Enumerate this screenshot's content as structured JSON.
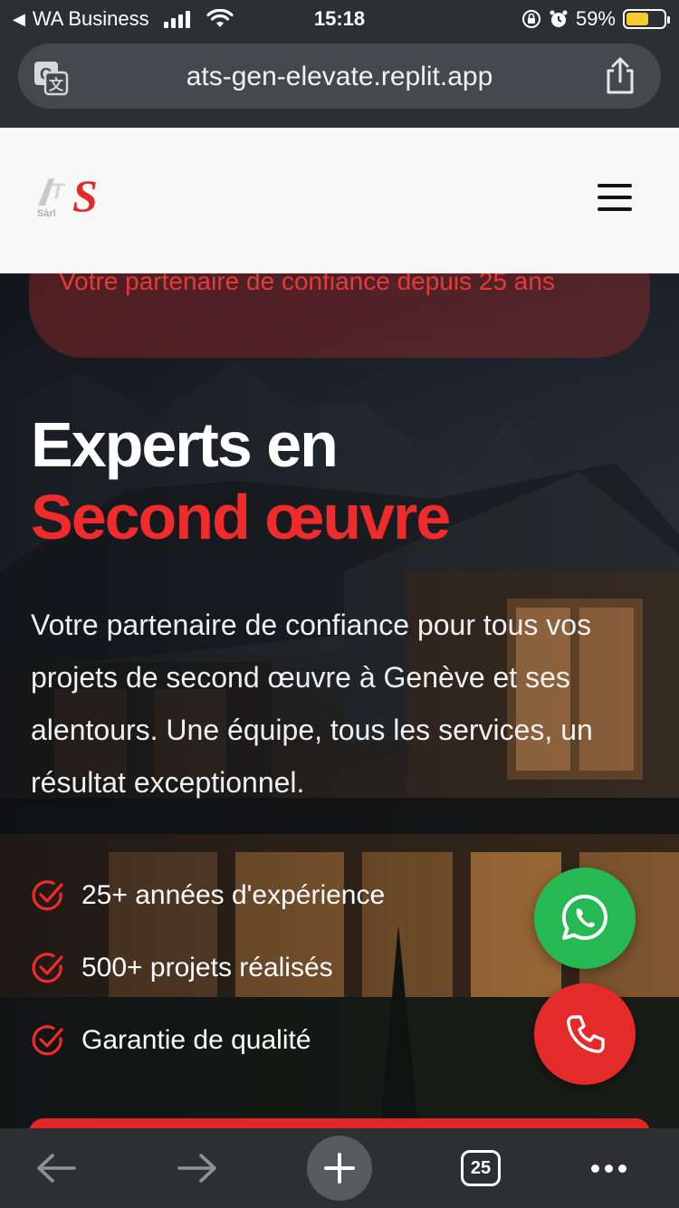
{
  "status_bar": {
    "back_app": "WA Business",
    "time": "15:18",
    "battery_percent": "59%",
    "battery_level": 0.59,
    "battery_color": "#f5cc2c"
  },
  "browser": {
    "url": "ats-gen-elevate.replit.app",
    "icons": [
      "translate-icon",
      "share-icon"
    ]
  },
  "header": {
    "logo_text": "ATS",
    "logo_subtext": "Sàrl",
    "menu_icon": "hamburger-icon"
  },
  "hero": {
    "badge": "Votre partenaire de confiance depuis 25 ans",
    "title_line1": "Experts en",
    "title_line2": "Second œuvre",
    "description": "Votre partenaire de confiance pour tous vos projets de second œuvre à Genève et ses alentours. Une équipe, tous les services, un résultat exceptionnel.",
    "features": [
      {
        "label": "25+ années d'expérience",
        "icon": "check-circle-icon"
      },
      {
        "label": "500+ projets réalisés",
        "icon": "check-circle-icon"
      },
      {
        "label": "Garantie de qualité",
        "icon": "check-circle-icon"
      }
    ]
  },
  "floating_actions": {
    "whatsapp_icon": "whatsapp-icon",
    "call_icon": "phone-icon"
  },
  "toolbar": {
    "tab_count": "25",
    "icons": [
      "back-arrow-icon",
      "forward-arrow-icon",
      "plus-icon",
      "tabs-icon",
      "more-icon"
    ]
  },
  "colors": {
    "accent_red": "#ef2b2b",
    "whatsapp_green": "#26b853",
    "chrome_dark": "#2d3033"
  }
}
